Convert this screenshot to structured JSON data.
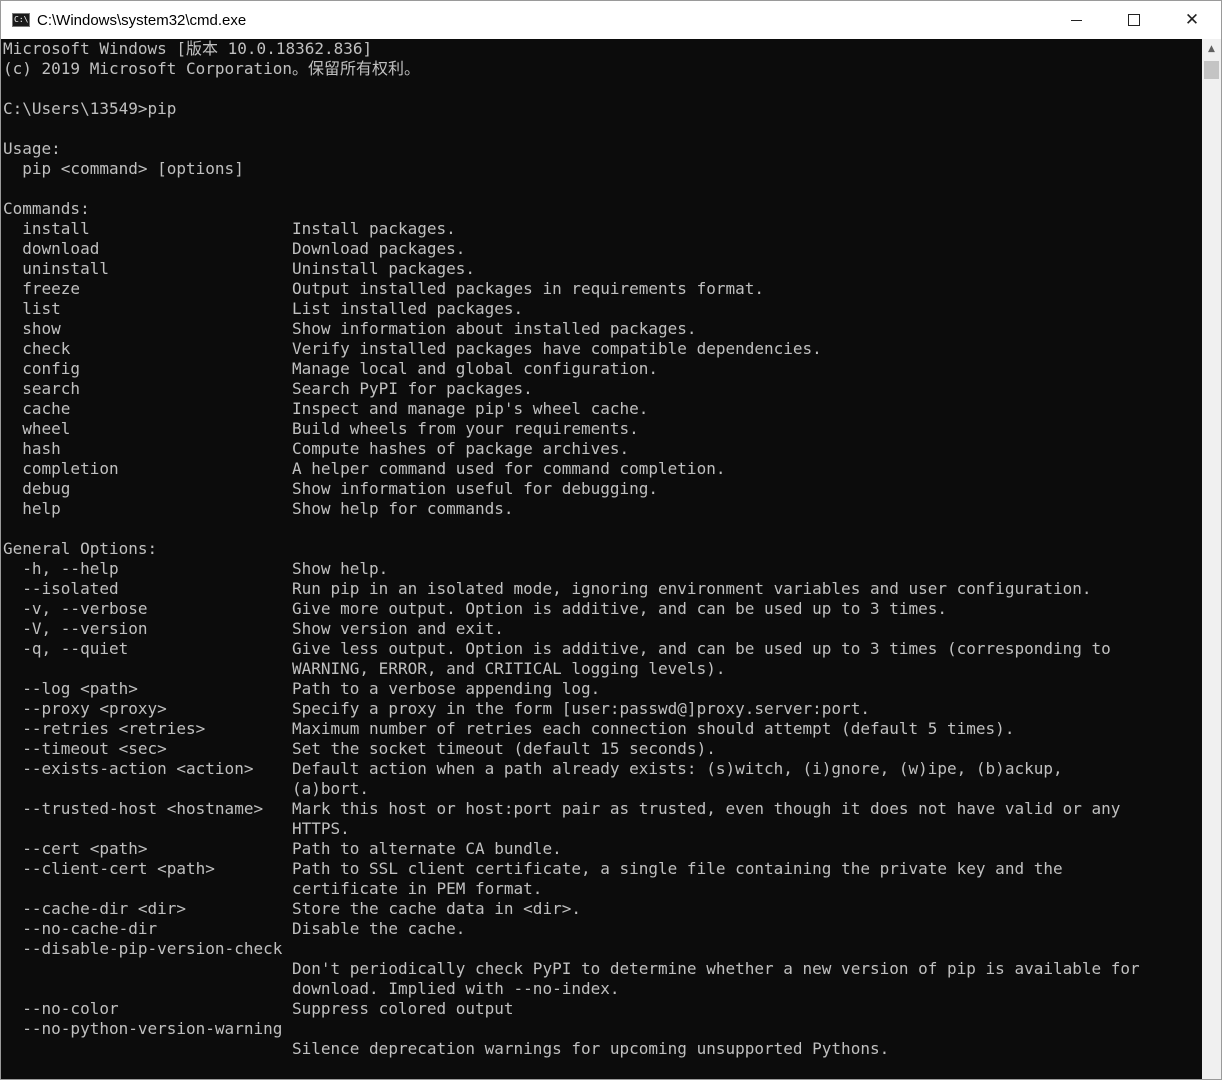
{
  "window": {
    "title": "C:\\Windows\\system32\\cmd.exe",
    "app_icon_glyph": "C:\\",
    "minimize_label": "",
    "maximize_label": "",
    "close_label": "✕"
  },
  "colors": {
    "console_background": "#0c0c0c",
    "console_text": "#c0c0c0",
    "titlebar_background": "#ffffff"
  },
  "console": {
    "lines": [
      "Microsoft Windows [版本 10.0.18362.836]",
      "(c) 2019 Microsoft Corporation。保留所有权利。",
      "",
      "C:\\Users\\13549>pip",
      "",
      "Usage:",
      "  pip <command> [options]",
      "",
      "Commands:",
      "  install                     Install packages.",
      "  download                    Download packages.",
      "  uninstall                   Uninstall packages.",
      "  freeze                      Output installed packages in requirements format.",
      "  list                        List installed packages.",
      "  show                        Show information about installed packages.",
      "  check                       Verify installed packages have compatible dependencies.",
      "  config                      Manage local and global configuration.",
      "  search                      Search PyPI for packages.",
      "  cache                       Inspect and manage pip's wheel cache.",
      "  wheel                       Build wheels from your requirements.",
      "  hash                        Compute hashes of package archives.",
      "  completion                  A helper command used for command completion.",
      "  debug                       Show information useful for debugging.",
      "  help                        Show help for commands.",
      "",
      "General Options:",
      "  -h, --help                  Show help.",
      "  --isolated                  Run pip in an isolated mode, ignoring environment variables and user configuration.",
      "  -v, --verbose               Give more output. Option is additive, and can be used up to 3 times.",
      "  -V, --version               Show version and exit.",
      "  -q, --quiet                 Give less output. Option is additive, and can be used up to 3 times (corresponding to",
      "                              WARNING, ERROR, and CRITICAL logging levels).",
      "  --log <path>                Path to a verbose appending log.",
      "  --proxy <proxy>             Specify a proxy in the form [user:passwd@]proxy.server:port.",
      "  --retries <retries>         Maximum number of retries each connection should attempt (default 5 times).",
      "  --timeout <sec>             Set the socket timeout (default 15 seconds).",
      "  --exists-action <action>    Default action when a path already exists: (s)witch, (i)gnore, (w)ipe, (b)ackup,",
      "                              (a)bort.",
      "  --trusted-host <hostname>   Mark this host or host:port pair as trusted, even though it does not have valid or any",
      "                              HTTPS.",
      "  --cert <path>               Path to alternate CA bundle.",
      "  --client-cert <path>        Path to SSL client certificate, a single file containing the private key and the",
      "                              certificate in PEM format.",
      "  --cache-dir <dir>           Store the cache data in <dir>.",
      "  --no-cache-dir              Disable the cache.",
      "  --disable-pip-version-check",
      "                              Don't periodically check PyPI to determine whether a new version of pip is available for",
      "                              download. Implied with --no-index.",
      "  --no-color                  Suppress colored output",
      "  --no-python-version-warning",
      "                              Silence deprecation warnings for upcoming unsupported Pythons."
    ]
  }
}
